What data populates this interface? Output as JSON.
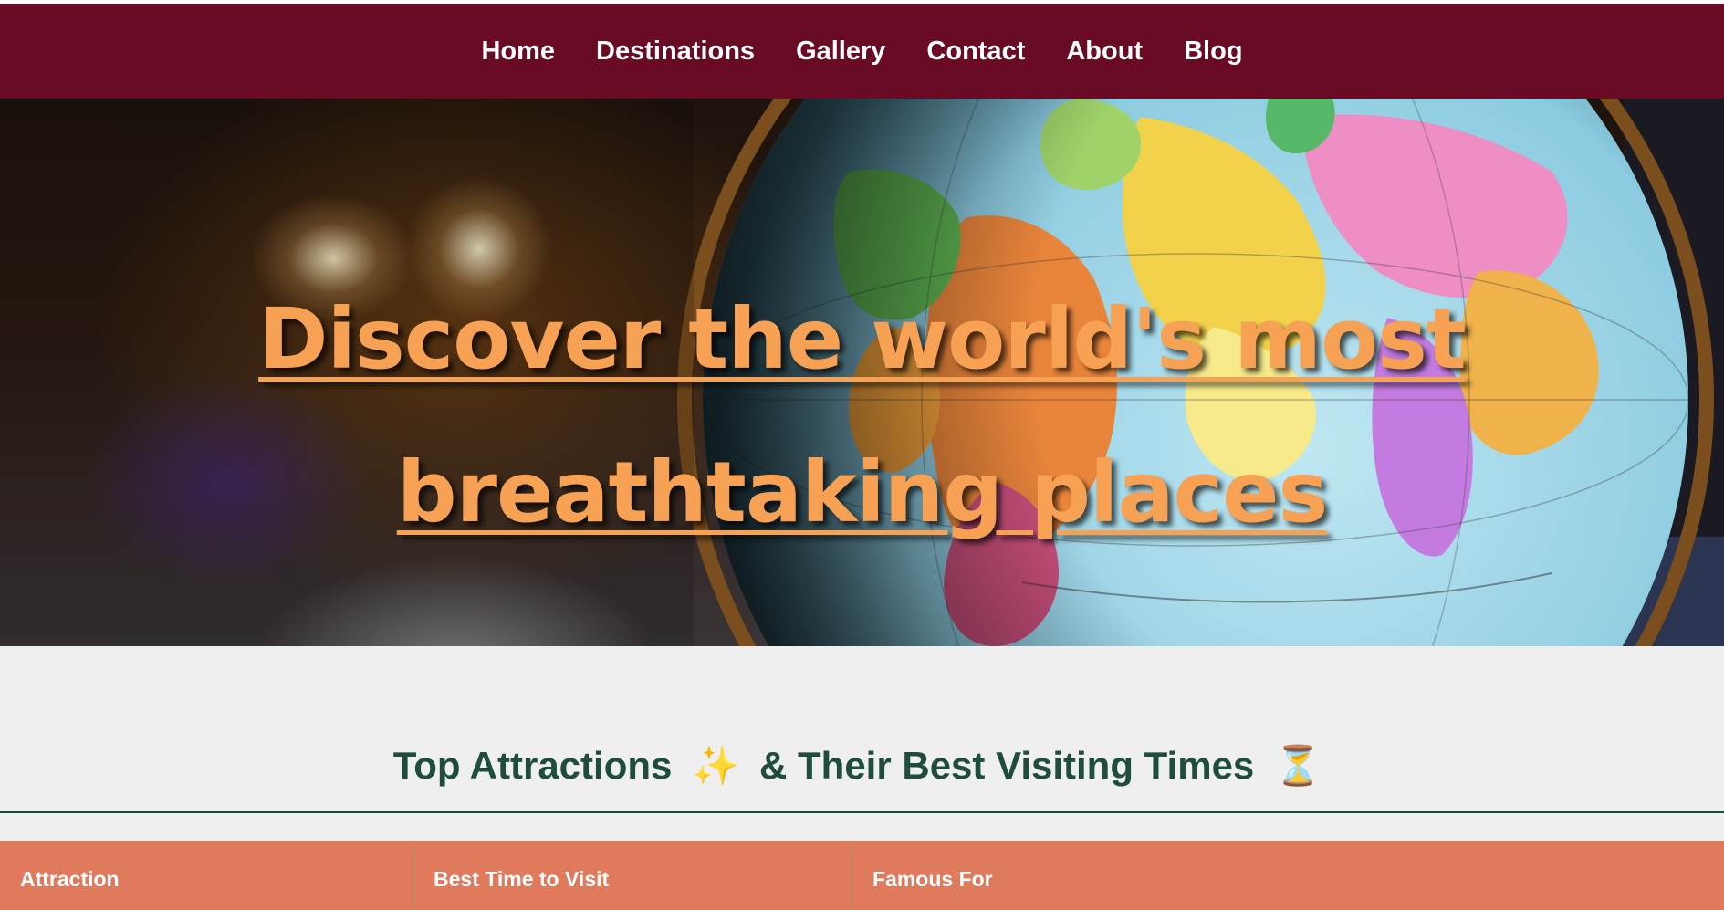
{
  "nav": {
    "items": [
      "Home",
      "Destinations",
      "Gallery",
      "Contact",
      "About",
      "Blog"
    ]
  },
  "hero": {
    "title": "Discover the world's most breathtaking places"
  },
  "section": {
    "title_part1": "Top Attractions",
    "icon1": "✨",
    "title_part2": "& Their Best Visiting Times",
    "icon2": "⏳",
    "icon1_name": "sparkles-icon",
    "icon2_name": "hourglass-icon"
  },
  "table": {
    "headers": [
      "Attraction",
      "Best Time to Visit",
      "Famous For"
    ]
  },
  "colors": {
    "nav_background": "#690b24",
    "hero_title": "#f6a153",
    "section_title": "#1e4c3e",
    "table_header": "#df7a5d",
    "page_background": "#efefef"
  }
}
